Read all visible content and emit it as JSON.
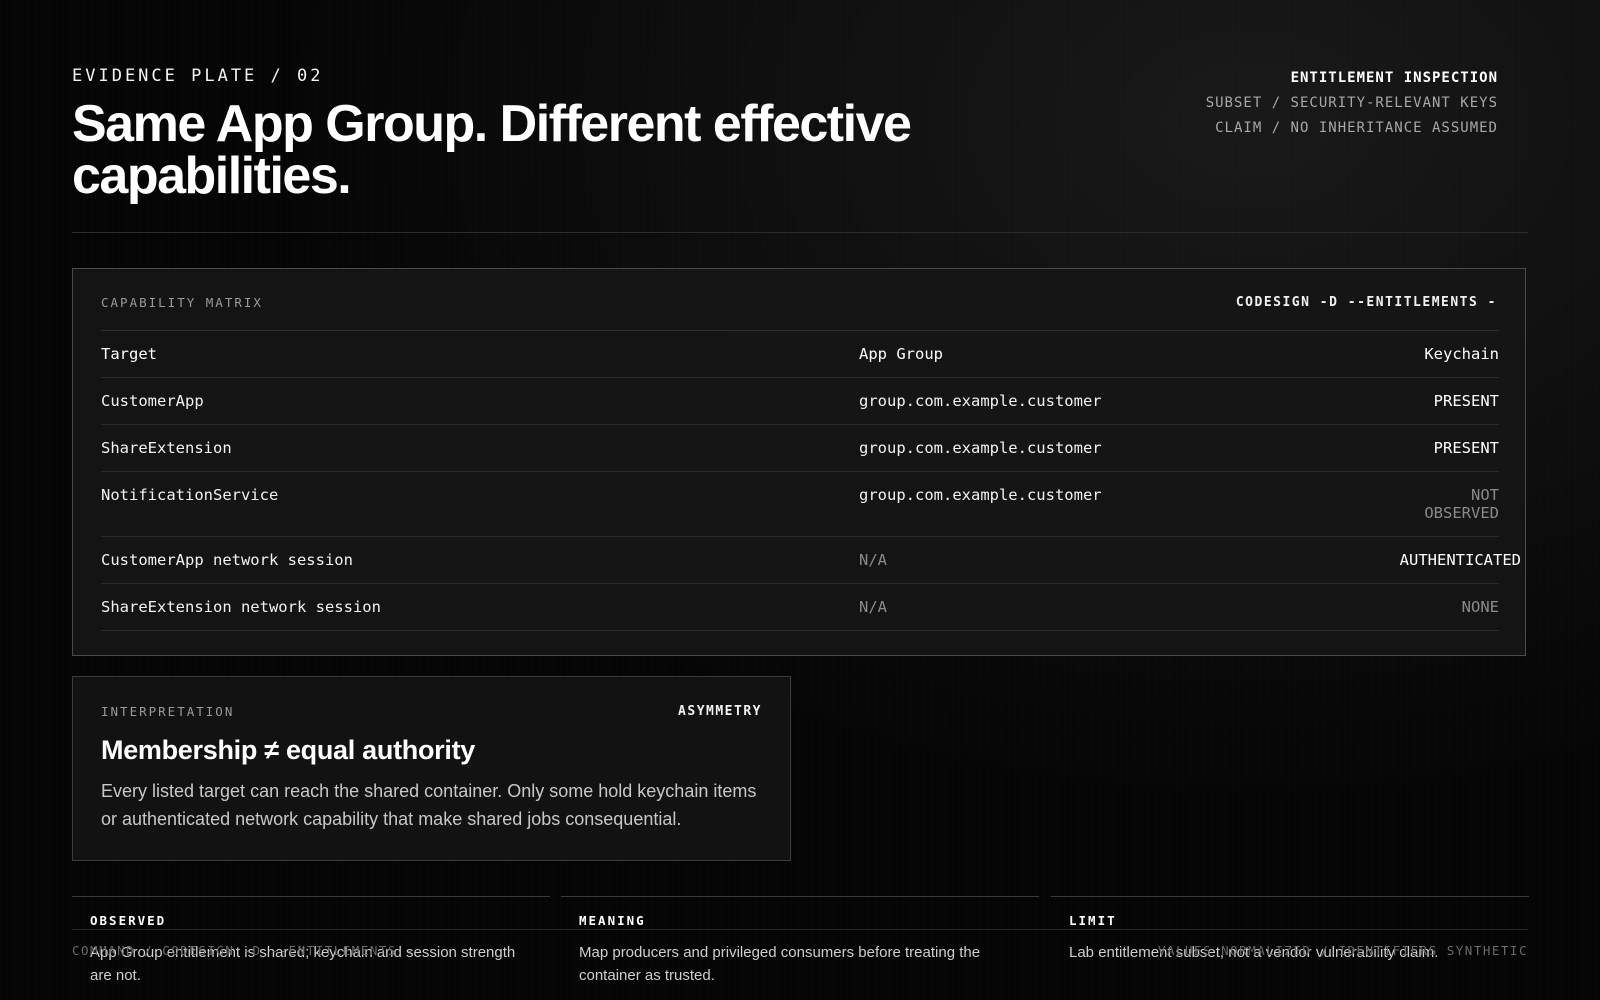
{
  "header": {
    "eyebrow": "EVIDENCE PLATE / 02",
    "title": "Same App Group. Different effective capabilities.",
    "meta": {
      "line1": "ENTITLEMENT INSPECTION",
      "line2": "SUBSET / SECURITY-RELEVANT KEYS",
      "line3": "CLAIM / NO INHERITANCE ASSUMED"
    }
  },
  "matrix": {
    "label": "CAPABILITY MATRIX",
    "command": "CODESIGN -D --ENTITLEMENTS -",
    "columns": [
      "Target",
      "App Group",
      "Keychain"
    ],
    "rows": [
      {
        "target": "CustomerApp",
        "group": "group.com.example.customer",
        "keychain": "PRESENT"
      },
      {
        "target": "ShareExtension",
        "group": "group.com.example.customer",
        "keychain": "PRESENT"
      },
      {
        "target": "NotificationService",
        "group": "group.com.example.customer",
        "keychain": "NOT OBSERVED"
      },
      {
        "target": "CustomerApp network session",
        "group": "N/A",
        "keychain": "AUTHENTICATED"
      },
      {
        "target": "ShareExtension network session",
        "group": "N/A",
        "keychain": "NONE"
      }
    ]
  },
  "interpretation": {
    "label": "INTERPRETATION",
    "tag": "ASYMMETRY",
    "title": "Membership ≠ equal authority",
    "body": "Every listed target can reach the shared container. Only some hold keychain items or authenticated network capability that make shared jobs consequential."
  },
  "columns": [
    {
      "label": "OBSERVED",
      "body": "App Group entitlement is shared; keychain and session strength are not."
    },
    {
      "label": "MEANING",
      "body": "Map producers and privileged consumers before treating the container as trusted."
    },
    {
      "label": "LIMIT",
      "body": "Lab entitlement subset, not a vendor vulnerability claim."
    }
  ],
  "footer": {
    "left": "COMMAND / CODESIGN -D --ENTITLEMENTS -",
    "right": "VALUES NORMALIZED / IDENTIFIERS SYNTHETIC"
  }
}
